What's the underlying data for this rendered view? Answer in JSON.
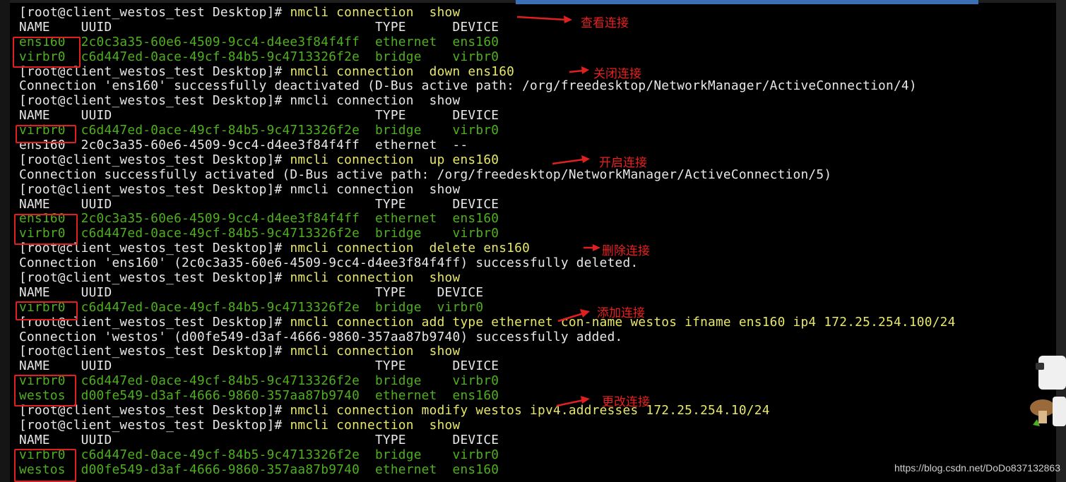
{
  "prompt": "[root@client_westos_test Desktop]#",
  "terminal_lines": [
    {
      "segments": [
        {
          "t": "[root@client_westos_test Desktop]# ",
          "c": "w"
        },
        {
          "t": "nmcli connection  show",
          "c": "y"
        }
      ]
    },
    {
      "segments": [
        {
          "t": "NAME    UUID                                  TYPE      DEVICE",
          "c": "w"
        }
      ]
    },
    {
      "segments": [
        {
          "t": "ens160  2c0c3a35-60e6-4509-9cc4-d4ee3f84f4ff  ethernet  ens160",
          "c": "g"
        }
      ]
    },
    {
      "segments": [
        {
          "t": "virbr0  c6d447ed-0ace-49cf-84b5-9c4713326f2e  bridge    virbr0",
          "c": "g"
        }
      ]
    },
    {
      "segments": [
        {
          "t": "[root@client_westos_test Desktop]# ",
          "c": "w"
        },
        {
          "t": "nmcli connection  down ens160",
          "c": "y"
        }
      ]
    },
    {
      "segments": [
        {
          "t": "Connection 'ens160' successfully deactivated (D-Bus active path: /org/freedesktop/NetworkManager/ActiveConnection/4)",
          "c": "w"
        }
      ]
    },
    {
      "segments": [
        {
          "t": "[root@client_westos_test Desktop]# nmcli connection  show",
          "c": "w"
        }
      ]
    },
    {
      "segments": [
        {
          "t": "NAME    UUID                                  TYPE      DEVICE",
          "c": "w"
        }
      ]
    },
    {
      "segments": [
        {
          "t": "virbr0  c6d447ed-0ace-49cf-84b5-9c4713326f2e  bridge    virbr0",
          "c": "g"
        }
      ]
    },
    {
      "segments": [
        {
          "t": "ens160  2c0c3a35-60e6-4509-9cc4-d4ee3f84f4ff  ethernet  --",
          "c": "w"
        }
      ]
    },
    {
      "segments": [
        {
          "t": "[root@client_westos_test Desktop]# ",
          "c": "w"
        },
        {
          "t": "nmcli connection  up ens160",
          "c": "y"
        }
      ]
    },
    {
      "segments": [
        {
          "t": "Connection successfully activated (D-Bus active path: /org/freedesktop/NetworkManager/ActiveConnection/5)",
          "c": "w"
        }
      ]
    },
    {
      "segments": [
        {
          "t": "[root@client_westos_test Desktop]# nmcli connection  show",
          "c": "w"
        }
      ]
    },
    {
      "segments": [
        {
          "t": "NAME    UUID                                  TYPE      DEVICE",
          "c": "w"
        }
      ]
    },
    {
      "segments": [
        {
          "t": "ens160  2c0c3a35-60e6-4509-9cc4-d4ee3f84f4ff  ethernet  ens160",
          "c": "g"
        }
      ]
    },
    {
      "segments": [
        {
          "t": "virbr0  c6d447ed-0ace-49cf-84b5-9c4713326f2e  bridge    virbr0",
          "c": "g"
        }
      ]
    },
    {
      "segments": [
        {
          "t": "[root@client_westos_test Desktop]# ",
          "c": "w"
        },
        {
          "t": "nmcli connection  delete ens160",
          "c": "y"
        }
      ]
    },
    {
      "segments": [
        {
          "t": "Connection 'ens160' (2c0c3a35-60e6-4509-9cc4-d4ee3f84f4ff) successfully deleted.",
          "c": "w"
        }
      ]
    },
    {
      "segments": [
        {
          "t": "[root@client_westos_test Desktop]# ",
          "c": "w"
        },
        {
          "t": "nmcli connection  show",
          "c": "y"
        }
      ]
    },
    {
      "segments": [
        {
          "t": "NAME    UUID                                  TYPE    DEVICE",
          "c": "w"
        }
      ]
    },
    {
      "segments": [
        {
          "t": "virbr0  c6d447ed-0ace-49cf-84b5-9c4713326f2e  bridge  virbr0",
          "c": "g"
        }
      ]
    },
    {
      "segments": [
        {
          "t": "[root@client_westos_test Desktop]# ",
          "c": "w"
        },
        {
          "t": "nmcli connection add type ethernet con-name westos ifname ens160 ip4 172.25.254.100/24",
          "c": "y"
        }
      ]
    },
    {
      "segments": [
        {
          "t": "Connection 'westos' (d00fe549-d3af-4666-9860-357aa87b9740) successfully added.",
          "c": "w"
        }
      ]
    },
    {
      "segments": [
        {
          "t": "[root@client_westos_test Desktop]# ",
          "c": "w"
        },
        {
          "t": "nmcli connection  show",
          "c": "y"
        }
      ]
    },
    {
      "segments": [
        {
          "t": "NAME    UUID                                  TYPE      DEVICE",
          "c": "w"
        }
      ]
    },
    {
      "segments": [
        {
          "t": "virbr0  c6d447ed-0ace-49cf-84b5-9c4713326f2e  bridge    virbr0",
          "c": "g"
        }
      ]
    },
    {
      "segments": [
        {
          "t": "westos  d00fe549-d3af-4666-9860-357aa87b9740  ethernet  ens160",
          "c": "g"
        }
      ]
    },
    {
      "segments": [
        {
          "t": "[root@client_westos_test Desktop]# ",
          "c": "w"
        },
        {
          "t": "nmcli connection modify westos ipv4.addresses 172.25.254.10/24",
          "c": "y"
        }
      ]
    },
    {
      "segments": [
        {
          "t": "[root@client_westos_test Desktop]# ",
          "c": "w"
        },
        {
          "t": "nmcli connection  show",
          "c": "y"
        }
      ]
    },
    {
      "segments": [
        {
          "t": "NAME    UUID                                  TYPE      DEVICE",
          "c": "w"
        }
      ]
    },
    {
      "segments": [
        {
          "t": "virbr0  c6d447ed-0ace-49cf-84b5-9c4713326f2e  bridge    virbr0",
          "c": "g"
        }
      ]
    },
    {
      "segments": [
        {
          "t": "westos  d00fe549-d3af-4666-9860-357aa87b9740  ethernet  ens160",
          "c": "g"
        }
      ]
    }
  ],
  "annotations": {
    "view": "查看连接",
    "close": "关闭连接",
    "open": "开启连接",
    "delete": "删除连接",
    "add": "添加连接",
    "modify": "更改连接"
  },
  "watermark": "https://blog.csdn.net/DoDo837132863",
  "colors": {
    "prompt_text": "#e8e8e8",
    "command_text": "#e7e76a",
    "connection_rows": "#4fb01f",
    "annotation_red": "#e02020",
    "background": "#000000"
  }
}
